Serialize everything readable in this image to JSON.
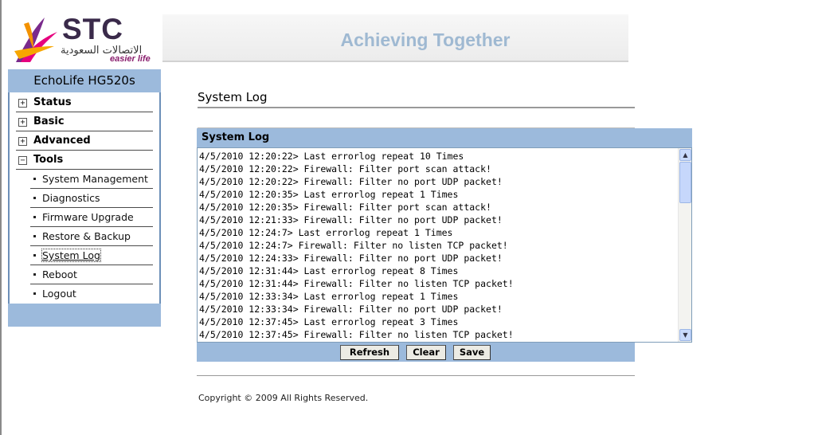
{
  "brand": {
    "name": "STC",
    "arabic": "الاتصالات السعودية",
    "tagline": "easier life"
  },
  "banner": {
    "slogan": "Achieving Together"
  },
  "sidebar": {
    "device": "EchoLife HG520s",
    "menu": [
      {
        "label": "Status",
        "icon": "plus-box-icon"
      },
      {
        "label": "Basic",
        "icon": "plus-box-icon"
      },
      {
        "label": "Advanced",
        "icon": "plus-box-icon"
      },
      {
        "label": "Tools",
        "icon": "minus-box-icon"
      }
    ],
    "tools_items": [
      {
        "label": "System Management"
      },
      {
        "label": "Diagnostics"
      },
      {
        "label": "Firmware Upgrade"
      },
      {
        "label": "Restore & Backup"
      },
      {
        "label": "System Log",
        "active": true
      },
      {
        "label": "Reboot"
      },
      {
        "label": "Logout"
      }
    ]
  },
  "page": {
    "title": "System Log"
  },
  "log": {
    "header": "System Log",
    "lines": [
      "4/5/2010 12:20:22> Last errorlog repeat 10 Times",
      "4/5/2010 12:20:22> Firewall: Filter port scan attack!",
      "4/5/2010 12:20:22> Firewall: Filter no port UDP packet!",
      "4/5/2010 12:20:35> Last errorlog repeat 1 Times",
      "4/5/2010 12:20:35> Firewall: Filter port scan attack!",
      "4/5/2010 12:21:33> Firewall: Filter no port UDP packet!",
      "4/5/2010 12:24:7> Last errorlog repeat 1 Times",
      "4/5/2010 12:24:7> Firewall: Filter no listen TCP packet!",
      "4/5/2010 12:24:33> Firewall: Filter no port UDP packet!",
      "4/5/2010 12:31:44> Last errorlog repeat 8 Times",
      "4/5/2010 12:31:44> Firewall: Filter no listen TCP packet!",
      "4/5/2010 12:33:34> Last errorlog repeat 1 Times",
      "4/5/2010 12:33:34> Firewall: Filter no port UDP packet!",
      "4/5/2010 12:37:45> Last errorlog repeat 3 Times",
      "4/5/2010 12:37:45> Firewall: Filter no listen TCP packet!"
    ]
  },
  "buttons": {
    "refresh": "Refresh",
    "clear": "Clear",
    "save": "Save"
  },
  "footer": {
    "copyright": "Copyright © 2009 All Rights Reserved."
  },
  "colors": {
    "panel_blue": "#9cbadc",
    "slogan": "#9fb9d2",
    "tagline": "#8a1f6e"
  }
}
